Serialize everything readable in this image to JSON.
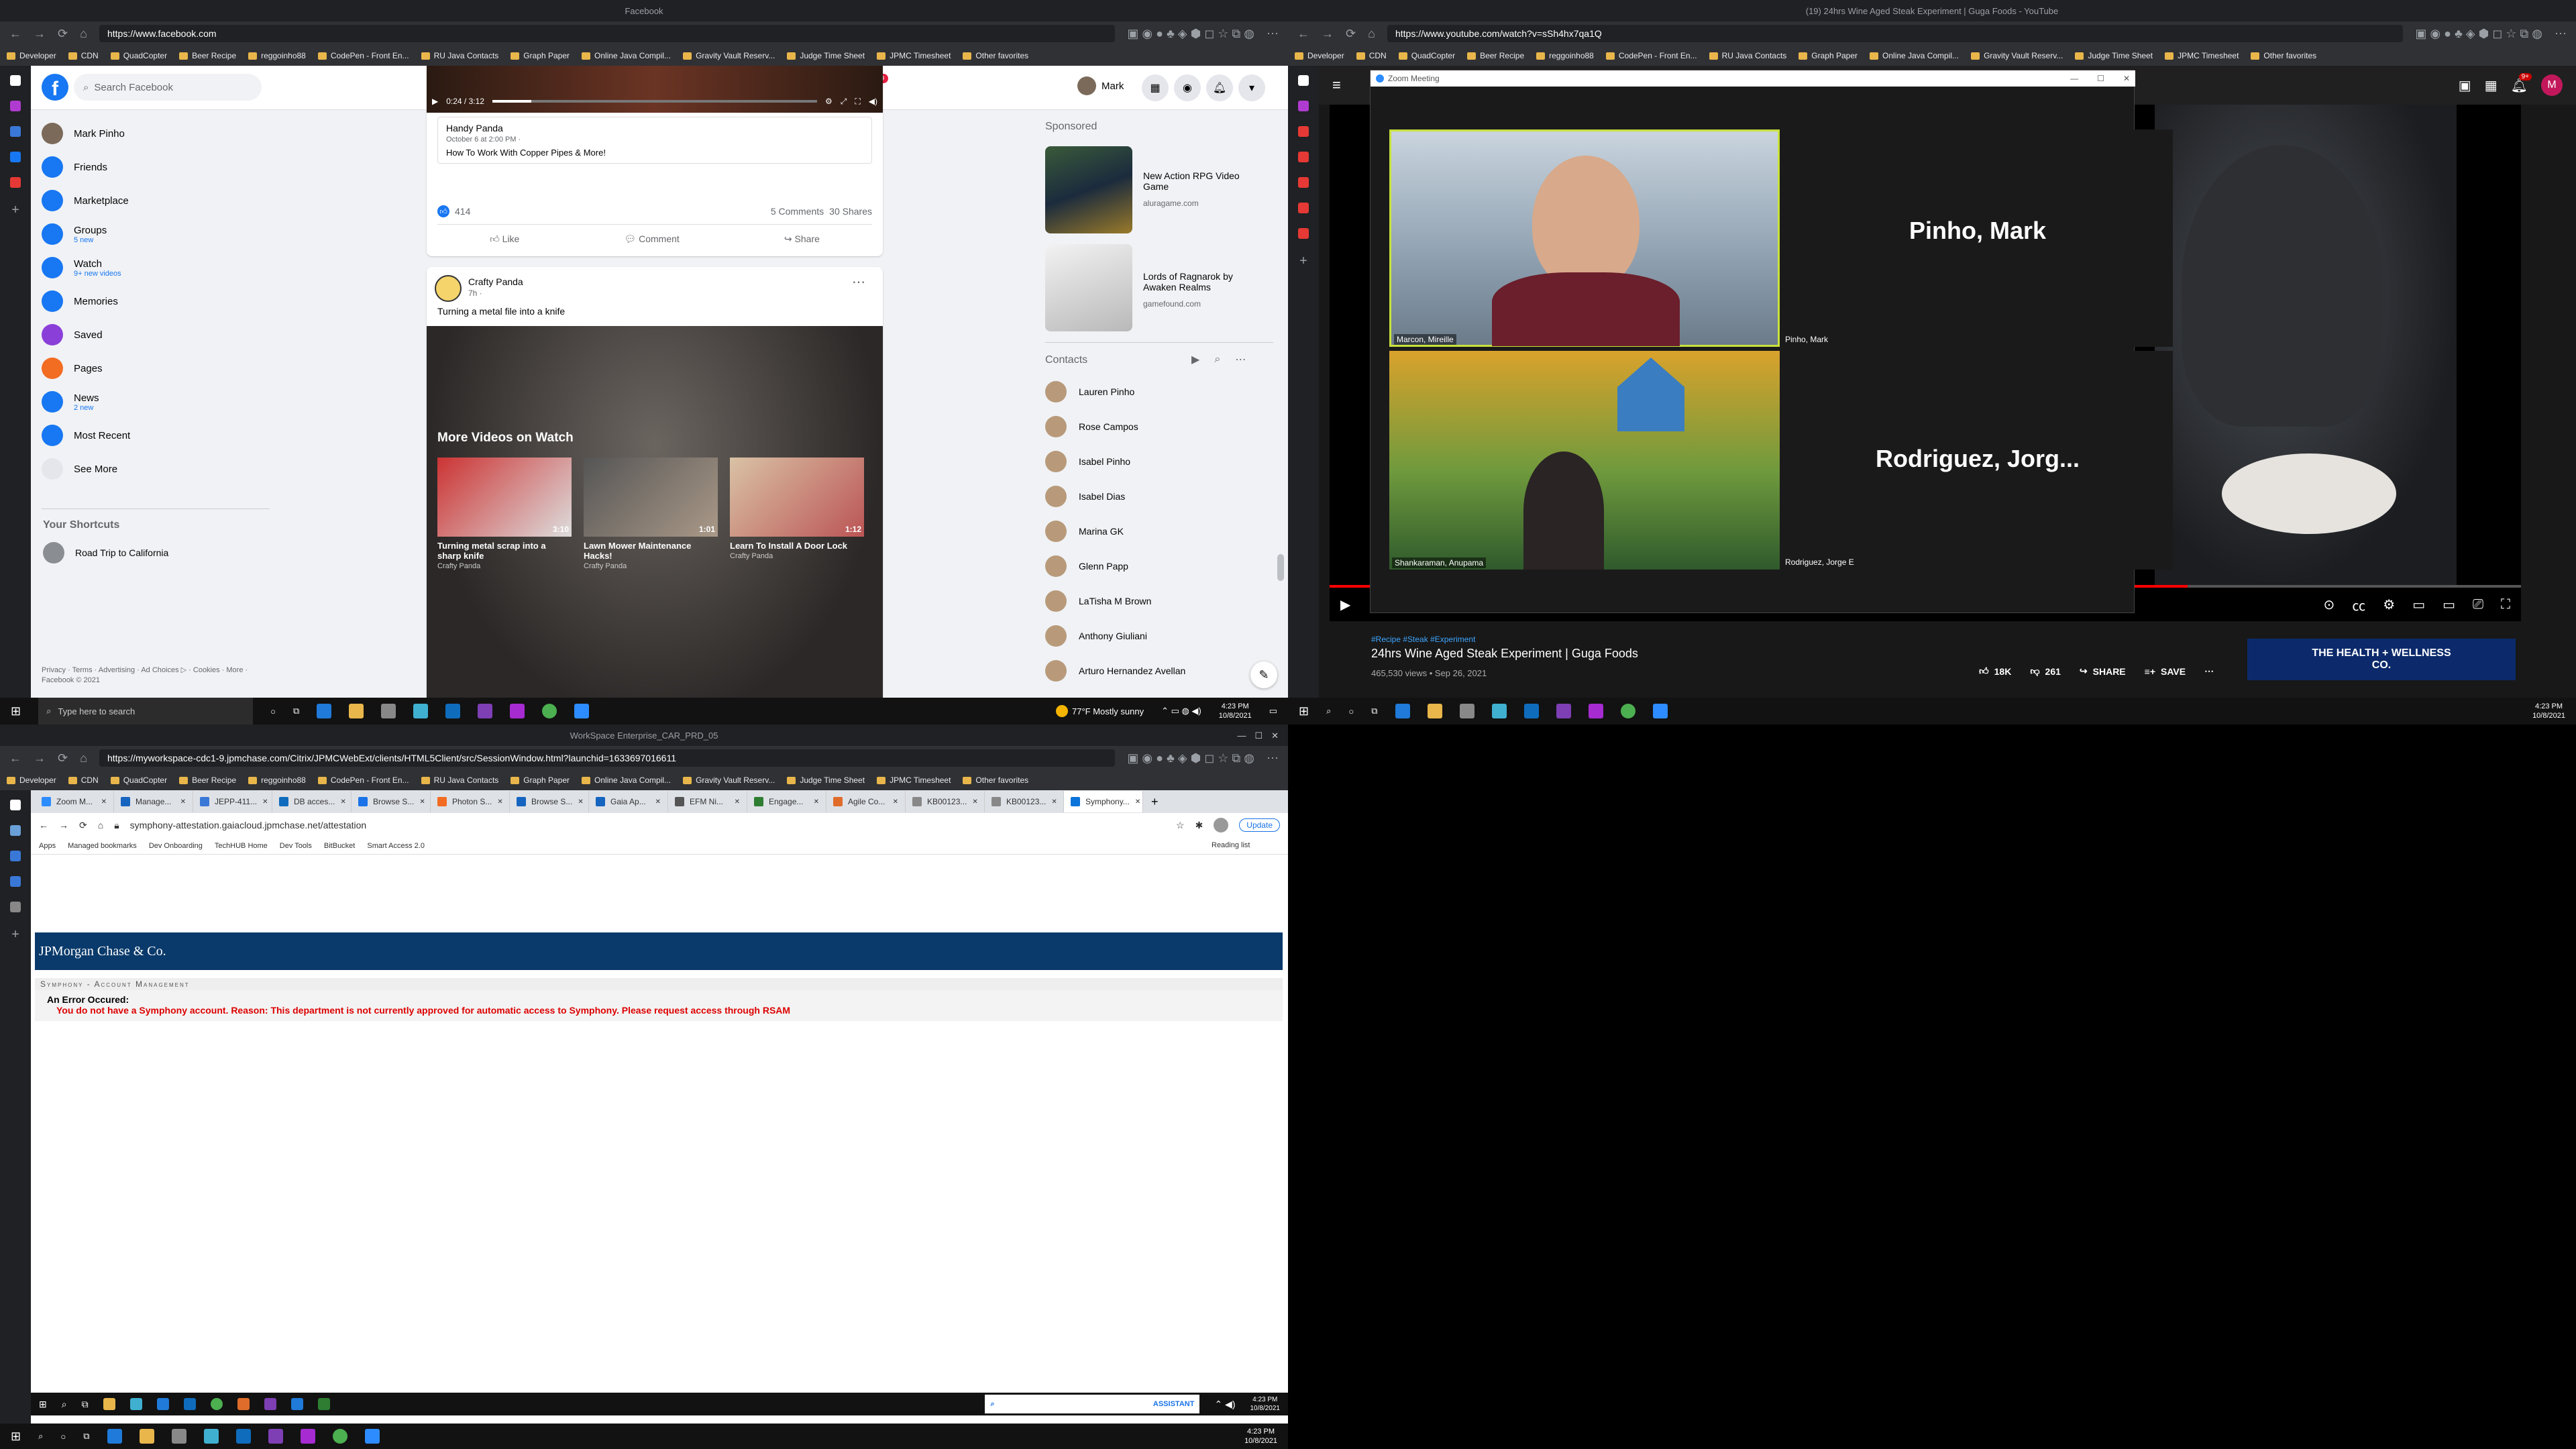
{
  "fb_window": {
    "title": "Facebook",
    "url": "https://www.facebook.com",
    "bookmarks": [
      "Developer",
      "CDN",
      "QuadCopter",
      "Beer Recipe",
      "reggoinho88",
      "CodePen - Front En...",
      "RU Java Contacts",
      "Graph Paper",
      "Online Java Compil...",
      "Gravity Vault Reserv...",
      "Judge Time Sheet",
      "JPMC Timesheet",
      "Other favorites"
    ],
    "search_placeholder": "Search Facebook",
    "user_name": "Mark",
    "badges": {
      "video": "9+",
      "groups": "9",
      "gaming": "9"
    },
    "sidebar": [
      {
        "label": "Mark Pinho",
        "sub": "",
        "color": "#7b6a5a"
      },
      {
        "label": "Friends",
        "sub": "",
        "color": "#1877f2"
      },
      {
        "label": "Marketplace",
        "sub": "",
        "color": "#1877f2"
      },
      {
        "label": "Groups",
        "sub": "5 new",
        "color": "#1877f2"
      },
      {
        "label": "Watch",
        "sub": "9+ new videos",
        "color": "#1877f2"
      },
      {
        "label": "Memories",
        "sub": "",
        "color": "#1877f2"
      },
      {
        "label": "Saved",
        "sub": "",
        "color": "#8b3fd9"
      },
      {
        "label": "Pages",
        "sub": "",
        "color": "#f26c22"
      },
      {
        "label": "News",
        "sub": "2 new",
        "color": "#1877f2"
      },
      {
        "label": "Most Recent",
        "sub": "",
        "color": "#1877f2"
      },
      {
        "label": "See More",
        "sub": "",
        "color": "#e4e6eb"
      }
    ],
    "shortcuts_title": "Your Shortcuts",
    "shortcut": "Road Trip to California",
    "footer": "Privacy · Terms · Advertising · Ad Choices ▷ · Cookies · More · Facebook © 2021",
    "post1": {
      "time": "0:24 / 3:12",
      "author": "Handy Panda",
      "date": "October 6 at 2:00 PM · ",
      "caption": "How To Work With Copper Pipes & More!",
      "likes": "414",
      "comments": "5 Comments",
      "shares": "30 Shares",
      "like": "Like",
      "comment": "Comment",
      "share": "Share"
    },
    "post2": {
      "author": "Crafty Panda",
      "time": "7h · ",
      "caption": "Turning a metal file into a knife",
      "more_title": "More Videos on Watch",
      "videos": [
        {
          "title": "Turning metal scrap into a sharp knife",
          "channel": "Crafty Panda",
          "duration": "3:10"
        },
        {
          "title": "Lawn Mower Maintenance Hacks!",
          "channel": "Crafty Panda",
          "duration": "1:01"
        },
        {
          "title": "Learn To Install A Door Lock",
          "channel": "Crafty Panda",
          "duration": "1:12"
        }
      ]
    },
    "sponsored_title": "Sponsored",
    "ads": [
      {
        "title": "New Action RPG Video Game",
        "domain": "aluragame.com"
      },
      {
        "title": "Lords of Ragnarok by Awaken Realms",
        "domain": "gamefound.com"
      }
    ],
    "contacts_title": "Contacts",
    "contacts": [
      "Lauren Pinho",
      "Rose Campos",
      "Isabel Pinho",
      "Isabel Dias",
      "Marina GK",
      "Glenn Papp",
      "LaTisha M Brown",
      "Anthony Giuliani",
      "Arturo Hernandez Avellan"
    ]
  },
  "yt_window": {
    "title": "(19) 24hrs Wine Aged Steak Experiment | Guga Foods - YouTube",
    "url": "https://www.youtube.com/watch?v=sSh4hx7qa1Q",
    "notif": "9+",
    "avatar": "M",
    "tags": "#Recipe #Steak #Experiment",
    "video_title": "24hrs Wine Aged Steak Experiment | Guga Foods",
    "views": "465,530 views • Sep 26, 2021",
    "likes": "18K",
    "dislikes": "261",
    "share": "SHARE",
    "save": "SAVE",
    "ad_text": "THE HEALTH + WELLNESS CO."
  },
  "zoom": {
    "title": "Zoom Meeting",
    "p1": "Marcon, Mireille",
    "p2": "Pinho, Mark",
    "p2_big": "Pinho, Mark",
    "p3": "Shankaraman, Anupama",
    "p4": "Rodriguez, Jorge E",
    "p4_big": "Rodriguez, Jorg..."
  },
  "citrix_window": {
    "title": "WorkSpace Enterprise_CAR_PRD_05",
    "url": "https://myworkspace-cdc1-9.jpmchase.com/Citrix/JPMCWebExt/clients/HTML5Client/src/SessionWindow.html?launchid=1633697016611",
    "tabs": [
      "Zoom M...",
      "Manage...",
      "JEPP-411...",
      "DB acces...",
      "Browse S...",
      "Photon S...",
      "Browse S...",
      "Gaia Ap...",
      "EFM Ni...",
      "Engage...",
      "Agile Co...",
      "KB00123...",
      "KB00123...",
      "Symphony..."
    ],
    "inner_url": "symphony-attestation.gaiacloud.jpmchase.net/attestation",
    "update": "Update",
    "inner_bookmarks": [
      "Apps",
      "Managed bookmarks",
      "Dev Onboarding",
      "TechHUB Home",
      "Dev Tools",
      "BitBucket",
      "Smart Access 2.0"
    ],
    "reading_list": "Reading list",
    "logo": "JPMorgan Chase & Co.",
    "section": "Symphony - Account Management",
    "error_title": "An Error Occured:",
    "error_msg": "You do not have a Symphony account. Reason: This department is not currently approved for automatic access to Symphony. Please request access through RSAM",
    "assistant": "ASSISTANT",
    "time": "4:23 PM",
    "date": "10/8/2021"
  },
  "taskbar": {
    "search": "Type here to search",
    "weather": "77°F  Mostly sunny",
    "time": "4:23 PM",
    "date": "10/8/2021"
  }
}
